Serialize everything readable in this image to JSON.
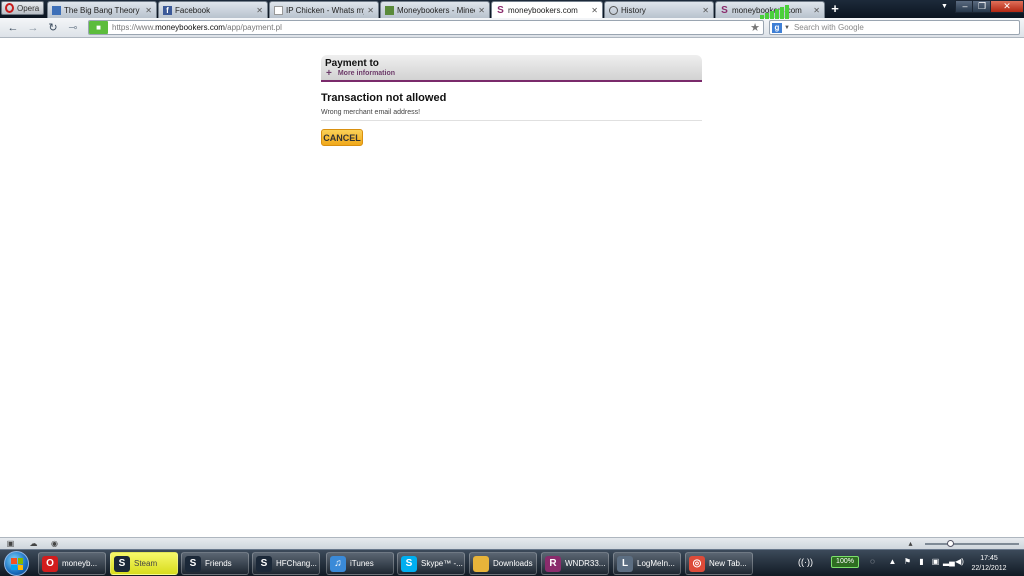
{
  "browser": {
    "menu_label": "Opera",
    "tabs": [
      {
        "title": "The Big Bang Theory S...",
        "icon": "tv-icon",
        "active": false
      },
      {
        "title": "Facebook",
        "icon": "facebook-icon",
        "active": false
      },
      {
        "title": "IP Chicken - Whats my ...",
        "icon": "page-icon",
        "active": false
      },
      {
        "title": "Moneybookers - Minec...",
        "icon": "minecraft-icon",
        "active": false
      },
      {
        "title": "moneybookers.com",
        "icon": "moneybookers-icon",
        "active": true
      },
      {
        "title": "History",
        "icon": "clock-icon",
        "active": false
      },
      {
        "title": "moneybookers.com",
        "icon": "moneybookers-icon",
        "active": false
      }
    ],
    "url_prefix": "https://www.",
    "url_host": "moneybookers.com",
    "url_path": "/app/payment.pl",
    "search_placeholder": "Search with Google"
  },
  "page": {
    "panel_title": "Payment to",
    "more_info": "More information",
    "error_title": "Transaction not allowed",
    "error_message": "Wrong merchant email address!",
    "cancel_label": "CANCEL"
  },
  "taskbar": {
    "items": [
      {
        "label": "moneyb...",
        "icon": "opera-icon",
        "color": "#d21d1d"
      },
      {
        "label": "Steam",
        "icon": "steam-icon",
        "color": "#1b2838",
        "highlight": true
      },
      {
        "label": "Friends",
        "icon": "steam-icon",
        "color": "#1b2838"
      },
      {
        "label": "HFChang...",
        "icon": "steam-icon",
        "color": "#1b2838"
      },
      {
        "label": "iTunes",
        "icon": "itunes-icon",
        "color": "#3a8ad8"
      },
      {
        "label": "Skype™ -...",
        "icon": "skype-icon",
        "color": "#00aff0"
      },
      {
        "label": "Downloads",
        "icon": "folder-icon",
        "color": "#e8b43a"
      },
      {
        "label": "WNDR33...",
        "icon": "winrar-icon",
        "color": "#8a2c6c"
      },
      {
        "label": "LogMeIn...",
        "icon": "logmein-icon",
        "color": "#5c6e82"
      },
      {
        "label": "New Tab...",
        "icon": "chrome-icon",
        "color": "#dd4b39"
      }
    ],
    "battery_percent": "100%",
    "clock_time": "17:45",
    "clock_date": "22/12/2012"
  }
}
